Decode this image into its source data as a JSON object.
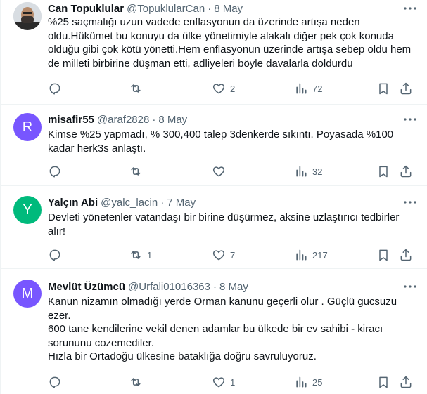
{
  "colors": {
    "text": "#0f1419",
    "secondary": "#536471",
    "divider": "#eff3f4",
    "avatar_r": "#7856ff",
    "avatar_y": "#00ba7c",
    "avatar_m": "#7856ff"
  },
  "tweets": [
    {
      "name": "Can Topuklular",
      "handle": "@TopuklularCan",
      "date": "8 May",
      "text": "%25 saçmalığı uzun vadede enflasyonun da üzerinde artışa neden oldu.Hükümet bu konuyu da ülke yönetimiyle alakalı diğer pek çok konuda olduğu gibi çok kötü yönetti.Hem enflasyonun üzerinde artışa sebep oldu hem de milleti birbirine düşman etti, adliyeleri böyle davalarla doldurdu",
      "avatar_icon": "photo-avatar",
      "replies": "",
      "retweets": "",
      "likes": "2",
      "views": "72"
    },
    {
      "name": "misafir55",
      "handle": "@araf2828",
      "date": "8 May",
      "text": "Kimse %25 yapmadı,  % 300,400 talep 3denkerde sıkıntı. Poyasada %100 kadar herk3s anlaştı.",
      "avatar_letter": "R",
      "replies": "",
      "retweets": "",
      "likes": "",
      "views": "32"
    },
    {
      "name": "Yalçın Abi",
      "handle": "@yalc_lacin",
      "date": "7 May",
      "text": "Devleti yönetenler vatandaşı bir birine düşürmez, aksine uzlaştırıcı tedbirler alır!",
      "avatar_letter": "Y",
      "replies": "",
      "retweets": "1",
      "likes": "7",
      "views": "217"
    },
    {
      "name": "Mevlüt Üzümcü",
      "handle": "@Urfali01016363",
      "date": "8 May",
      "text": "Kanun nizamın olmadığı yerde Orman kanunu geçerli olur . Güçlü gucsuzu ezer.\n600 tane kendilerine vekil denen adamlar bu ülkede bir ev sahibi - kiracı sorununu cozemediler.\nHızla bir Ortadoğu ülkesine bataklığa doğru savruluyoruz.",
      "avatar_letter": "M",
      "replies": "",
      "retweets": "",
      "likes": "1",
      "views": "25"
    }
  ]
}
